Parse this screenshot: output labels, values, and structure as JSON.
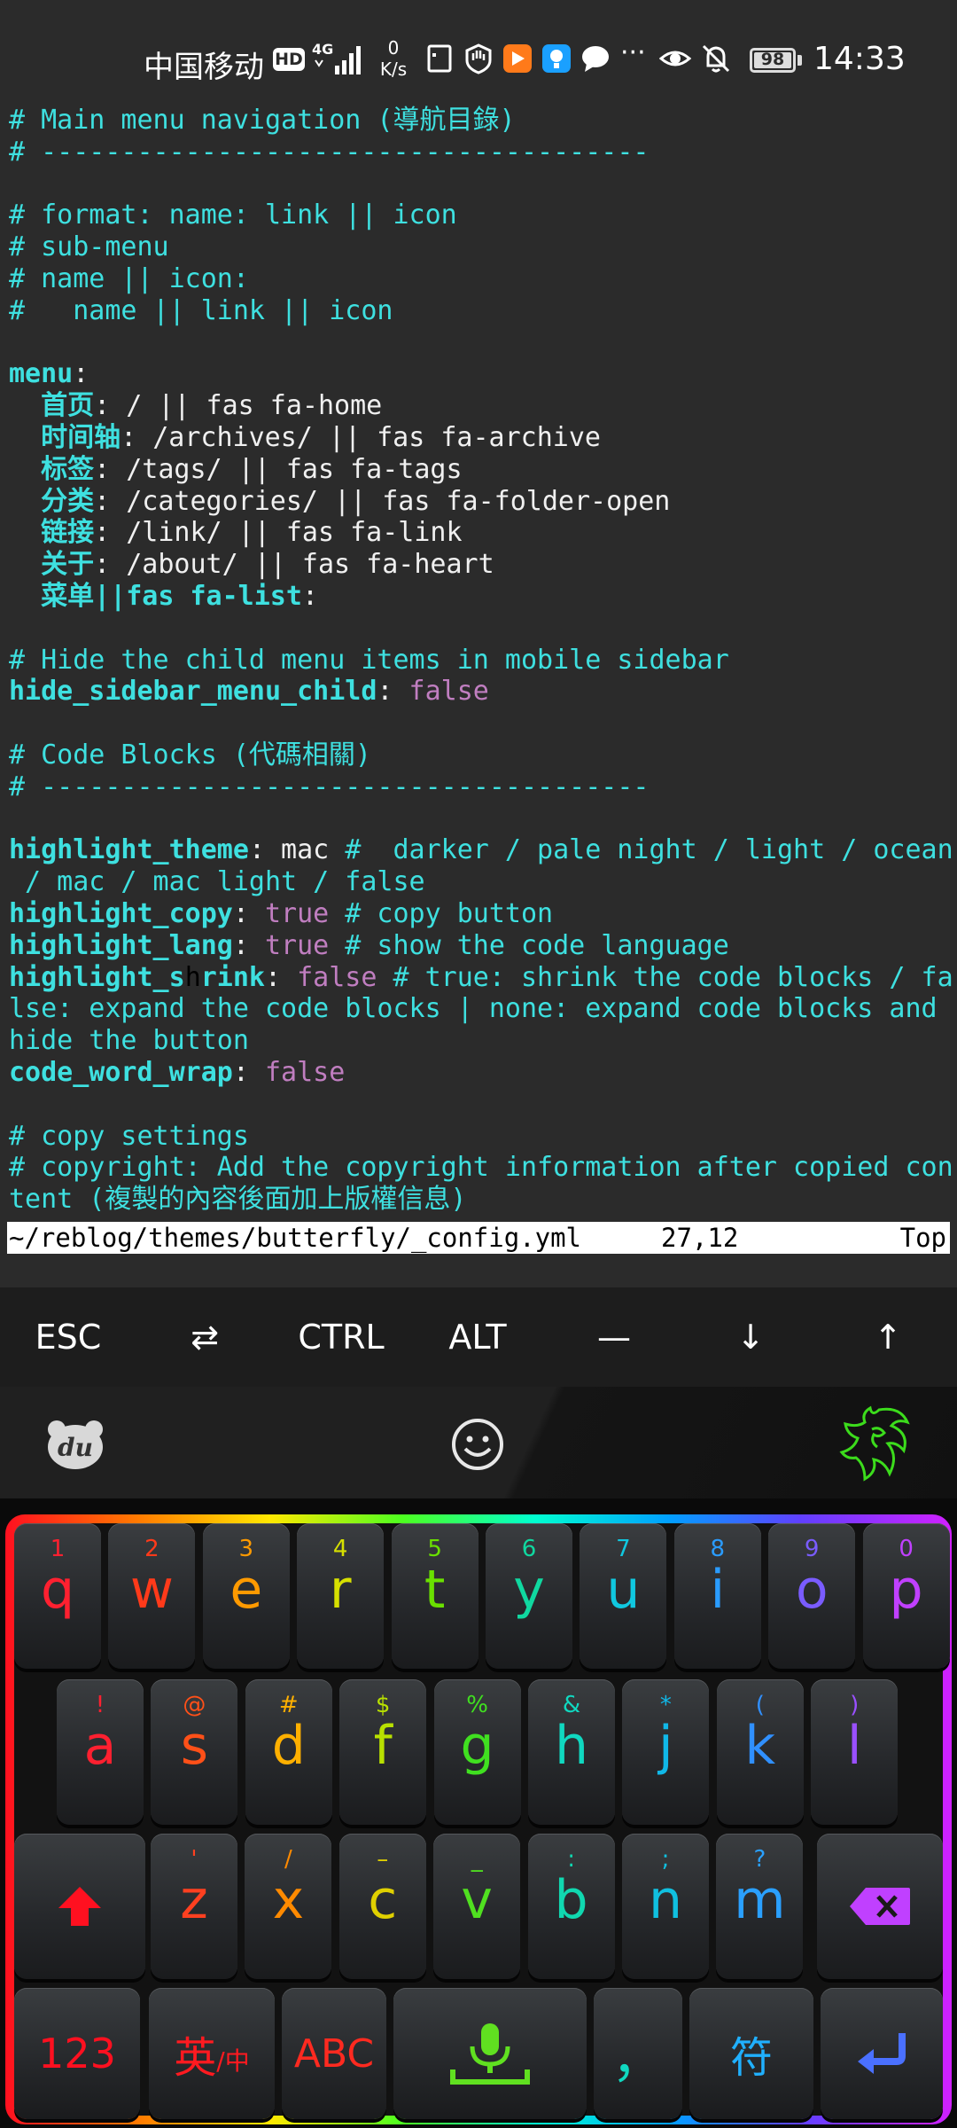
{
  "status_bar": {
    "carrier": "中国移动",
    "hd": "HD",
    "network": "4G",
    "speed_value": "0",
    "speed_unit": "K/s",
    "battery": "98",
    "time": "14:33",
    "icons": [
      "sim-card-icon",
      "shield-hand-icon",
      "orange-app-icon",
      "blue-app-icon",
      "chat-bubble-icon",
      "more-dots-icon",
      "eye-icon",
      "bell-off-icon"
    ]
  },
  "terminal": {
    "lines": [
      [
        {
          "t": "# Main menu navigation (導航目錄)",
          "c": "comment"
        }
      ],
      [
        {
          "t": "# --------------------------------------",
          "c": "comment"
        }
      ],
      [],
      [
        {
          "t": "# format: name: link || icon",
          "c": "comment"
        }
      ],
      [
        {
          "t": "# sub-menu",
          "c": "comment"
        }
      ],
      [
        {
          "t": "# name || icon:",
          "c": "comment"
        }
      ],
      [
        {
          "t": "#   name || link || icon",
          "c": "comment"
        }
      ],
      [],
      [
        {
          "t": "menu",
          "c": "key"
        },
        {
          "t": ":",
          "c": "plain"
        }
      ],
      [
        {
          "t": "  首页",
          "c": "key"
        },
        {
          "t": ": / || fas fa-home",
          "c": "plain"
        }
      ],
      [
        {
          "t": "  时间轴",
          "c": "key"
        },
        {
          "t": ": /archives/ || fas fa-archive",
          "c": "plain"
        }
      ],
      [
        {
          "t": "  标签",
          "c": "key"
        },
        {
          "t": ": /tags/ || fas fa-tags",
          "c": "plain"
        }
      ],
      [
        {
          "t": "  分类",
          "c": "key"
        },
        {
          "t": ": /categories/ || fas fa-folder-open",
          "c": "plain"
        }
      ],
      [
        {
          "t": "  链接",
          "c": "key"
        },
        {
          "t": ": /link/ || fas fa-link",
          "c": "plain"
        }
      ],
      [
        {
          "t": "  关于",
          "c": "key"
        },
        {
          "t": ": /about/ || fas fa-heart",
          "c": "plain"
        }
      ],
      [
        {
          "t": "  菜单||fas fa-list",
          "c": "key"
        },
        {
          "t": ":",
          "c": "plain"
        }
      ],
      [],
      [
        {
          "t": "# Hide the child menu items in mobile sidebar",
          "c": "comment"
        }
      ],
      [
        {
          "t": "hide_sidebar_menu_child",
          "c": "key"
        },
        {
          "t": ": ",
          "c": "plain"
        },
        {
          "t": "false",
          "c": "bool"
        }
      ],
      [],
      [
        {
          "t": "# Code Blocks (代碼相關)",
          "c": "comment"
        }
      ],
      [
        {
          "t": "# --------------------------------------",
          "c": "comment"
        }
      ],
      [],
      [
        {
          "t": "highlight_theme",
          "c": "key"
        },
        {
          "t": ": mac ",
          "c": "plain"
        },
        {
          "t": "#  darker / pale night / light / ocean",
          "c": "comment"
        }
      ],
      [
        {
          "t": " / mac / mac light / false",
          "c": "comment"
        }
      ],
      [
        {
          "t": "highlight_copy",
          "c": "key"
        },
        {
          "t": ": ",
          "c": "plain"
        },
        {
          "t": "true",
          "c": "bool"
        },
        {
          "t": " # copy button",
          "c": "comment"
        }
      ],
      [
        {
          "t": "highlight_lang",
          "c": "key"
        },
        {
          "t": ": ",
          "c": "plain"
        },
        {
          "t": "true",
          "c": "bool"
        },
        {
          "t": " # show the code language",
          "c": "comment"
        }
      ],
      [
        {
          "t": "highlight_s",
          "c": "key"
        },
        {
          "t": "h",
          "c": "cursor"
        },
        {
          "t": "rink",
          "c": "key"
        },
        {
          "t": ": ",
          "c": "plain"
        },
        {
          "t": "false",
          "c": "bool"
        },
        {
          "t": " # true: shrink the code blocks / fa",
          "c": "comment"
        }
      ],
      [
        {
          "t": "lse: expand the code blocks | none: expand code blocks and",
          "c": "comment"
        }
      ],
      [
        {
          "t": "hide the button",
          "c": "comment"
        }
      ],
      [
        {
          "t": "code_word_wrap",
          "c": "key"
        },
        {
          "t": ": ",
          "c": "plain"
        },
        {
          "t": "false",
          "c": "bool"
        }
      ],
      [],
      [
        {
          "t": "# copy settings",
          "c": "comment"
        }
      ],
      [
        {
          "t": "# copyright: Add the copyright information after copied con",
          "c": "comment"
        }
      ],
      [
        {
          "t": "tent (複製的內容後面加上版權信息)",
          "c": "comment"
        }
      ]
    ],
    "status_file": "~/reblog/themes/butterfly/_config.yml",
    "status_pos": "27,12",
    "status_scroll": "Top"
  },
  "extra_keys": [
    "ESC",
    "⇄",
    "CTRL",
    "ALT",
    "—",
    "↓",
    "↑"
  ],
  "ime_toolbar": {
    "left_icon": "du-bear-logo-icon",
    "center_icon": "emoji-smile-icon",
    "right_icon": "razer-snake-logo-icon"
  },
  "keyboard": {
    "row1": [
      {
        "main": "q",
        "sub": "1",
        "color": "#ff2030"
      },
      {
        "main": "w",
        "sub": "2",
        "color": "#ff3a1a"
      },
      {
        "main": "e",
        "sub": "3",
        "color": "#ff9a00"
      },
      {
        "main": "r",
        "sub": "4",
        "color": "#d7e000"
      },
      {
        "main": "t",
        "sub": "5",
        "color": "#6ae000"
      },
      {
        "main": "y",
        "sub": "6",
        "color": "#10d8a0"
      },
      {
        "main": "u",
        "sub": "7",
        "color": "#10c8e0"
      },
      {
        "main": "i",
        "sub": "8",
        "color": "#2a9cff"
      },
      {
        "main": "o",
        "sub": "9",
        "color": "#7a5cff"
      },
      {
        "main": "p",
        "sub": "0",
        "color": "#c040ff"
      }
    ],
    "row2": [
      {
        "main": "a",
        "sub": "!",
        "color": "#ff2030"
      },
      {
        "main": "s",
        "sub": "@",
        "color": "#ff5018"
      },
      {
        "main": "d",
        "sub": "#",
        "color": "#ffb000"
      },
      {
        "main": "f",
        "sub": "$",
        "color": "#b8e000"
      },
      {
        "main": "g",
        "sub": "%",
        "color": "#40e020"
      },
      {
        "main": "h",
        "sub": "&",
        "color": "#10d8c0"
      },
      {
        "main": "j",
        "sub": "*",
        "color": "#10b8e8"
      },
      {
        "main": "k",
        "sub": "(",
        "color": "#3090ff"
      },
      {
        "main": "l",
        "sub": ")",
        "color": "#9a50ff"
      }
    ],
    "row3": [
      {
        "main": "z",
        "sub": "'",
        "color": "#ff4020"
      },
      {
        "main": "x",
        "sub": "/",
        "color": "#ff8a00"
      },
      {
        "main": "c",
        "sub": "–",
        "color": "#e0d000"
      },
      {
        "main": "v",
        "sub": "_",
        "color": "#50e020"
      },
      {
        "main": "b",
        "sub": ":",
        "color": "#10d8b0"
      },
      {
        "main": "n",
        "sub": ";",
        "color": "#10c0e0"
      },
      {
        "main": "m",
        "sub": "?",
        "color": "#2aa0ff"
      }
    ],
    "shift_color": "#ff1020",
    "backspace_color": "#c040ff",
    "row4": {
      "num": "123",
      "lang_main": "英",
      "lang_sub": "/中",
      "abc": "ABC",
      "comma": "，",
      "symbol": "符",
      "num_color": "#ff1020",
      "lang_color": "#ff1a20",
      "abc_color": "#ff2a20",
      "mic_color": "#60e020",
      "comma_color": "#10d8c0",
      "symbol_color": "#20b0ff",
      "enter_color": "#4a70ff"
    }
  }
}
